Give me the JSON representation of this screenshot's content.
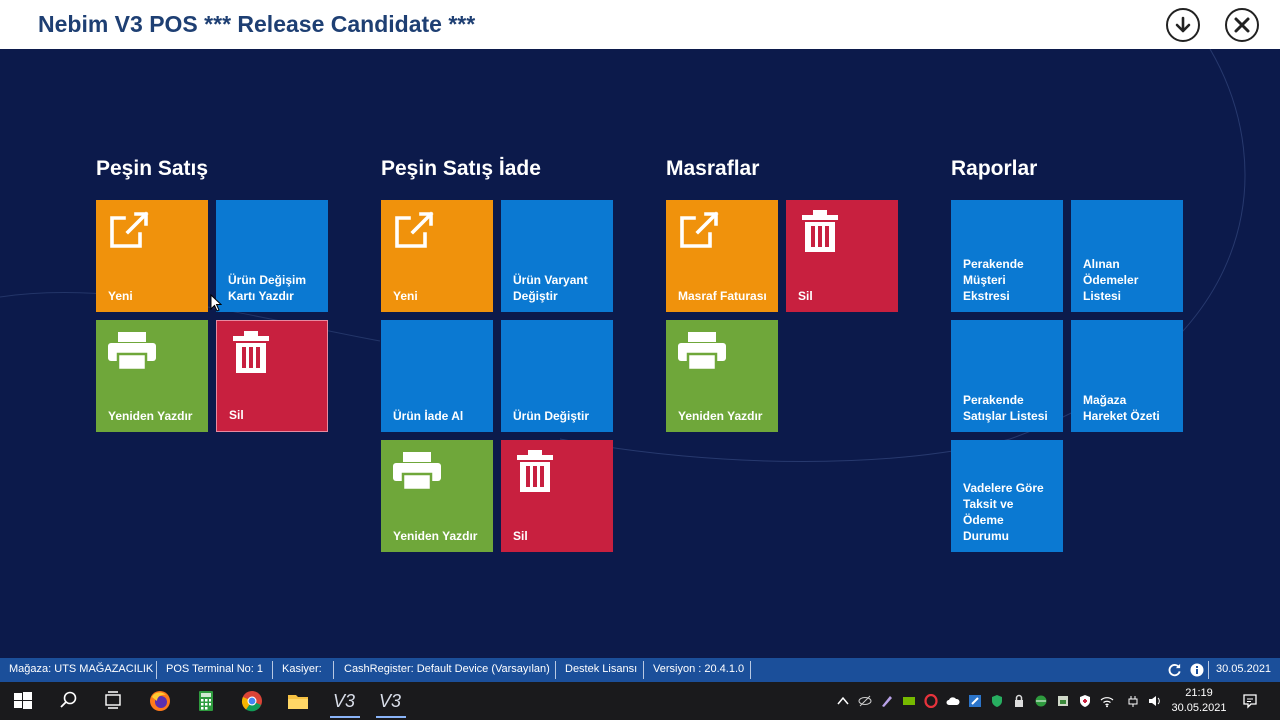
{
  "window": {
    "title": "Nebim V3 POS *** Release Candidate ***",
    "download_icon": "arrow-down-circle-icon",
    "close_icon": "close-circle-icon"
  },
  "groups": [
    {
      "title": "Peşin Satış",
      "tiles": [
        {
          "label": "Yeni",
          "color": "#f0920c",
          "icon": "external-link-icon"
        },
        {
          "label": "Ürün Değişim\nKartı Yazdır",
          "color": "#0b79d2",
          "icon": ""
        },
        {
          "label": "Yeniden Yazdır",
          "color": "#6fa73a",
          "icon": "printer-icon"
        },
        {
          "label": "Sil",
          "color": "#c8203f",
          "icon": "trash-icon"
        }
      ]
    },
    {
      "title": "Peşin Satış İade",
      "tiles": [
        {
          "label": "Yeni",
          "color": "#f0920c",
          "icon": "external-link-icon"
        },
        {
          "label": "Ürün Varyant\nDeğiştir",
          "color": "#0b79d2",
          "icon": ""
        },
        {
          "label": "Ürün İade Al",
          "color": "#0b79d2",
          "icon": ""
        },
        {
          "label": "Ürün Değiştir",
          "color": "#0b79d2",
          "icon": ""
        },
        {
          "label": "Yeniden Yazdır",
          "color": "#6fa73a",
          "icon": "printer-icon"
        },
        {
          "label": "Sil",
          "color": "#c8203f",
          "icon": "trash-icon"
        }
      ]
    },
    {
      "title": "Masraflar",
      "tiles": [
        {
          "label": "Masraf Faturası",
          "color": "#f0920c",
          "icon": "external-link-icon"
        },
        {
          "label": "Sil",
          "color": "#c8203f",
          "icon": "trash-icon"
        },
        {
          "label": "Yeniden Yazdır",
          "color": "#6fa73a",
          "icon": "printer-icon"
        }
      ]
    },
    {
      "title": "Raporlar",
      "tiles": [
        {
          "label": "Perakende\nMüşteri Ekstresi",
          "color": "#0b79d2",
          "icon": ""
        },
        {
          "label": "Alınan\nÖdemeler\nListesi",
          "color": "#0b79d2",
          "icon": ""
        },
        {
          "label": "Perakende\nSatışlar Listesi",
          "color": "#0b79d2",
          "icon": ""
        },
        {
          "label": "Mağaza\nHareket Özeti",
          "color": "#0b79d2",
          "icon": ""
        },
        {
          "label": "Vadelere Göre\nTaksit ve\nÖdeme\nDurumu",
          "color": "#0b79d2",
          "icon": ""
        }
      ]
    }
  ],
  "statusbar": {
    "store": "Mağaza: UTS MAĞAZACILIK",
    "terminal": "POS Terminal No: 1",
    "cashier": "Kasiyer:",
    "cash_register": "CashRegister: Default Device (Varsayılan)",
    "license": "Destek Lisansı",
    "version": "Versiyon : 20.4.1.0",
    "date": "30.05.2021",
    "refresh_icon": "refresh-icon",
    "info_icon": "info-icon"
  },
  "taskbar": {
    "time": "21:19",
    "date": "30.05.2021",
    "apps": [
      "windows-start-icon",
      "search-icon",
      "task-view-icon",
      "firefox-icon",
      "calculator-icon",
      "chrome-icon",
      "file-explorer-icon",
      "nebim-v3-icon",
      "nebim-v3-icon"
    ],
    "v3_label": "V3"
  }
}
